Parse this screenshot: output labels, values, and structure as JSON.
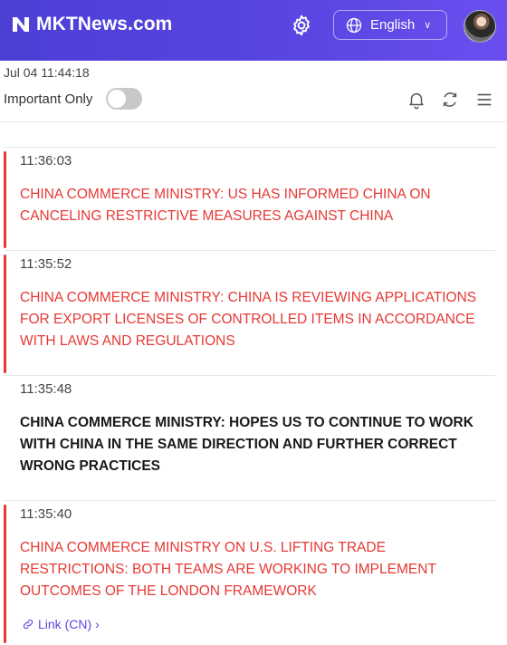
{
  "header": {
    "brand": "MKTNews.com",
    "language": "English"
  },
  "toolbar": {
    "datetime": "Jul 04 11:44:18",
    "important_only_label": "Important Only",
    "important_only": false
  },
  "news": [
    {
      "time": "11:36:03",
      "text": "CHINA COMMERCE MINISTRY: US HAS INFORMED CHINA ON CANCELING RESTRICTIVE MEASURES AGAINST CHINA",
      "important": true
    },
    {
      "time": "11:35:52",
      "text": "CHINA COMMERCE MINISTRY: CHINA IS REVIEWING APPLICATIONS FOR EXPORT LICENSES OF CONTROLLED ITEMS IN ACCORDANCE WITH LAWS AND REGULATIONS",
      "important": true
    },
    {
      "time": "11:35:48",
      "text": "CHINA COMMERCE MINISTRY: HOPES US TO CONTINUE TO WORK WITH CHINA IN THE SAME DIRECTION AND FURTHER CORRECT WRONG PRACTICES",
      "important": false
    },
    {
      "time": "11:35:40",
      "text": "CHINA COMMERCE MINISTRY ON U.S. LIFTING TRADE RESTRICTIONS: BOTH TEAMS ARE WORKING TO IMPLEMENT OUTCOMES OF THE LONDON FRAMEWORK",
      "important": true,
      "link": "Link (CN)"
    }
  ],
  "colors": {
    "brand": "#5a46e2",
    "important": "#e53935"
  }
}
